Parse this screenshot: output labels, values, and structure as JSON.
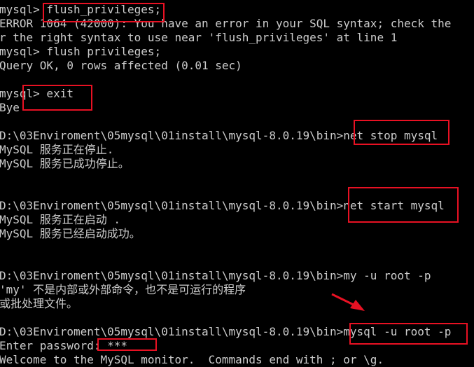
{
  "terminal": {
    "lines": [
      "mysql> flush_privileges;",
      "ERROR 1064 (42000): You have an error in your SQL syntax; check the",
      "r the right syntax to use near 'flush_privileges' at line 1",
      "mysql> flush privileges;",
      "Query OK, 0 rows affected (0.01 sec)",
      "",
      "mysql> exit",
      "Bye",
      "",
      "D:\\03Enviroment\\05mysql\\01install\\mysql-8.0.19\\bin>net stop mysql",
      "MySQL 服务正在停止.",
      "MySQL 服务已成功停止。",
      "",
      "",
      "D:\\03Enviroment\\05mysql\\01install\\mysql-8.0.19\\bin>net start mysql",
      "MySQL 服务正在启动 .",
      "MySQL 服务已经启动成功。",
      "",
      "",
      "D:\\03Enviroment\\05mysql\\01install\\mysql-8.0.19\\bin>my -u root -p",
      "'my' 不是内部或外部命令，也不是可运行的程序",
      "或批处理文件。",
      "",
      "D:\\03Enviroment\\05mysql\\01install\\mysql-8.0.19\\bin>mysql -u root -p",
      "Enter password: ***",
      "Welcome to the MySQL monitor.  Commands end with ; or \\g."
    ]
  },
  "colors": {
    "background": "#000000",
    "text": "#cccccc",
    "highlight": "#e81123"
  }
}
